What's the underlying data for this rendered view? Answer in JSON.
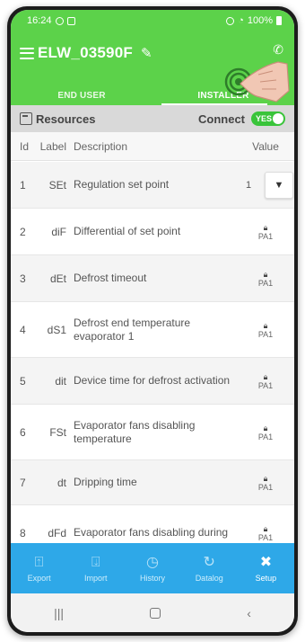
{
  "statusbar": {
    "time": "16:24",
    "battery": "100%"
  },
  "appbar": {
    "title": "ELW_03590F"
  },
  "tabs": [
    {
      "label": "END USER",
      "active": false
    },
    {
      "label": "INSTALLER",
      "active": true
    }
  ],
  "resources": {
    "label": "Resources",
    "connect_label": "Connect",
    "toggle_label": "YES"
  },
  "table": {
    "headers": {
      "id": "Id",
      "label": "Label",
      "description": "Description",
      "value": "Value"
    },
    "rows": [
      {
        "id": "1",
        "label": "SEt",
        "description": "Regulation set point",
        "value": "1",
        "protection": ""
      },
      {
        "id": "2",
        "label": "diF",
        "description": "Differential of set point",
        "value": "",
        "protection": "PA1"
      },
      {
        "id": "3",
        "label": "dEt",
        "description": "Defrost timeout",
        "value": "",
        "protection": "PA1"
      },
      {
        "id": "4",
        "label": "dS1",
        "description": "Defrost end temperature evaporator 1",
        "value": "",
        "protection": "PA1"
      },
      {
        "id": "5",
        "label": "dit",
        "description": "Device time for defrost activation",
        "value": "",
        "protection": "PA1"
      },
      {
        "id": "6",
        "label": "FSt",
        "description": "Evaporator fans disabling temperature",
        "value": "",
        "protection": "PA1"
      },
      {
        "id": "7",
        "label": "dt",
        "description": "Dripping time",
        "value": "",
        "protection": "PA1"
      },
      {
        "id": "8",
        "label": "dFd",
        "description": "Evaporator fans disabling during",
        "value": "",
        "protection": "PA1"
      }
    ]
  },
  "bottom_nav": [
    {
      "label": "Export",
      "icon": "export-icon",
      "glyph": "⍐"
    },
    {
      "label": "Import",
      "icon": "import-icon",
      "glyph": "⍗"
    },
    {
      "label": "History",
      "icon": "history-icon",
      "glyph": "◷"
    },
    {
      "label": "Datalog",
      "icon": "datalog-icon",
      "glyph": "↻"
    },
    {
      "label": "Setup",
      "icon": "setup-tools-icon",
      "glyph": "✖"
    }
  ],
  "colors": {
    "primary_green": "#5cd24a",
    "toggle_green": "#39c43a",
    "nav_blue": "#2ea8e8"
  }
}
